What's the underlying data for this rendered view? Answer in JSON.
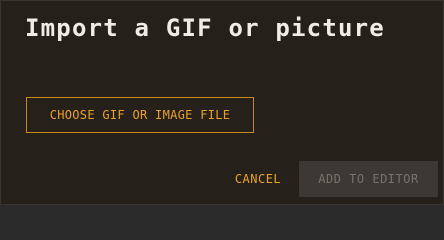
{
  "dialog": {
    "title": "Import a GIF or picture",
    "choose_button_label": "CHOOSE GIF OR IMAGE FILE",
    "cancel_label": "CANCEL",
    "add_label": "ADD TO EDITOR",
    "add_enabled": false
  },
  "colors": {
    "background": "#25201a",
    "title_text": "#f1ede6",
    "accent": "#e9a12a",
    "disabled_button_bg": "#3c3833",
    "disabled_button_text": "#77726b"
  }
}
